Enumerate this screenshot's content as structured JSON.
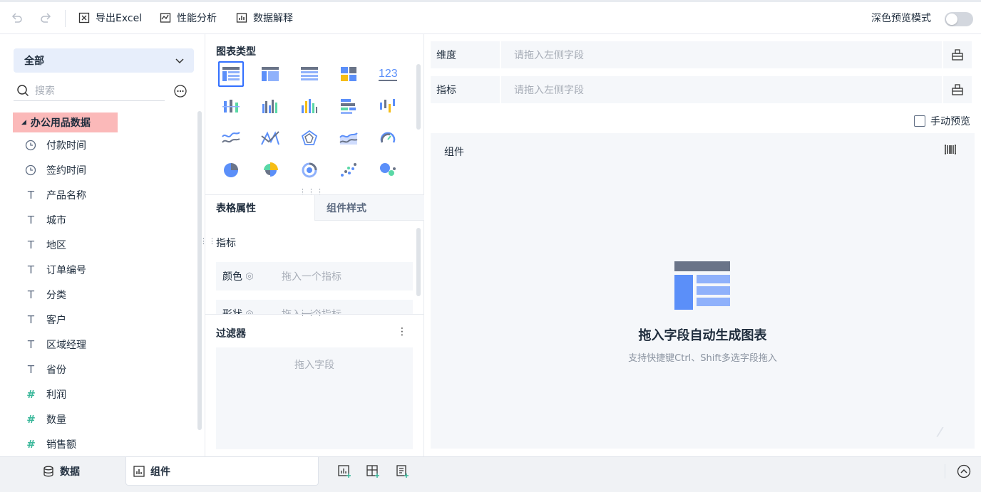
{
  "toolbar": {
    "undo_icon": "undo-icon",
    "redo_icon": "redo-icon",
    "export_excel": "导出Excel",
    "performance_analysis": "性能分析",
    "data_explain": "数据解释",
    "dark_preview": "深色预览模式",
    "dark_preview_on": false
  },
  "left": {
    "dataset_select": "全部",
    "search_placeholder": "搜索",
    "tree_root": "办公用品数据",
    "fields": [
      {
        "name": "付款时间",
        "type": "date"
      },
      {
        "name": "签约时间",
        "type": "date"
      },
      {
        "name": "产品名称",
        "type": "text"
      },
      {
        "name": "城市",
        "type": "text"
      },
      {
        "name": "地区",
        "type": "text"
      },
      {
        "name": "订单编号",
        "type": "text"
      },
      {
        "name": "分类",
        "type": "text"
      },
      {
        "name": "客户",
        "type": "text"
      },
      {
        "name": "区域经理",
        "type": "text"
      },
      {
        "name": "省份",
        "type": "text"
      },
      {
        "name": "利润",
        "type": "number"
      },
      {
        "name": "数量",
        "type": "number"
      },
      {
        "name": "销售额",
        "type": "number"
      }
    ]
  },
  "middle": {
    "chart_type_title": "图表类型",
    "tabs": [
      "表格属性",
      "组件样式"
    ],
    "indicator_label": "指标",
    "props": [
      {
        "label": "颜色",
        "placeholder": "拖入一个指标"
      },
      {
        "label": "形状",
        "placeholder": "拖入一个指标"
      }
    ],
    "filter_title": "过滤器",
    "filter_placeholder": "拖入字段"
  },
  "right": {
    "dimension_label": "维度",
    "dimension_placeholder": "请拖入左侧字段",
    "measure_label": "指标",
    "measure_placeholder": "请拖入左侧字段",
    "manual_preview": "手动预览",
    "canvas_title": "组件",
    "empty_title": "拖入字段自动生成图表",
    "empty_sub": "支持快捷键Ctrl、Shift多选字段拖入"
  },
  "bottom": {
    "tabs": [
      "数据",
      "组件"
    ]
  },
  "colors": {
    "accent": "#3370ff",
    "highlight": "#fbb9b9",
    "panel": "#f5f7fa"
  }
}
